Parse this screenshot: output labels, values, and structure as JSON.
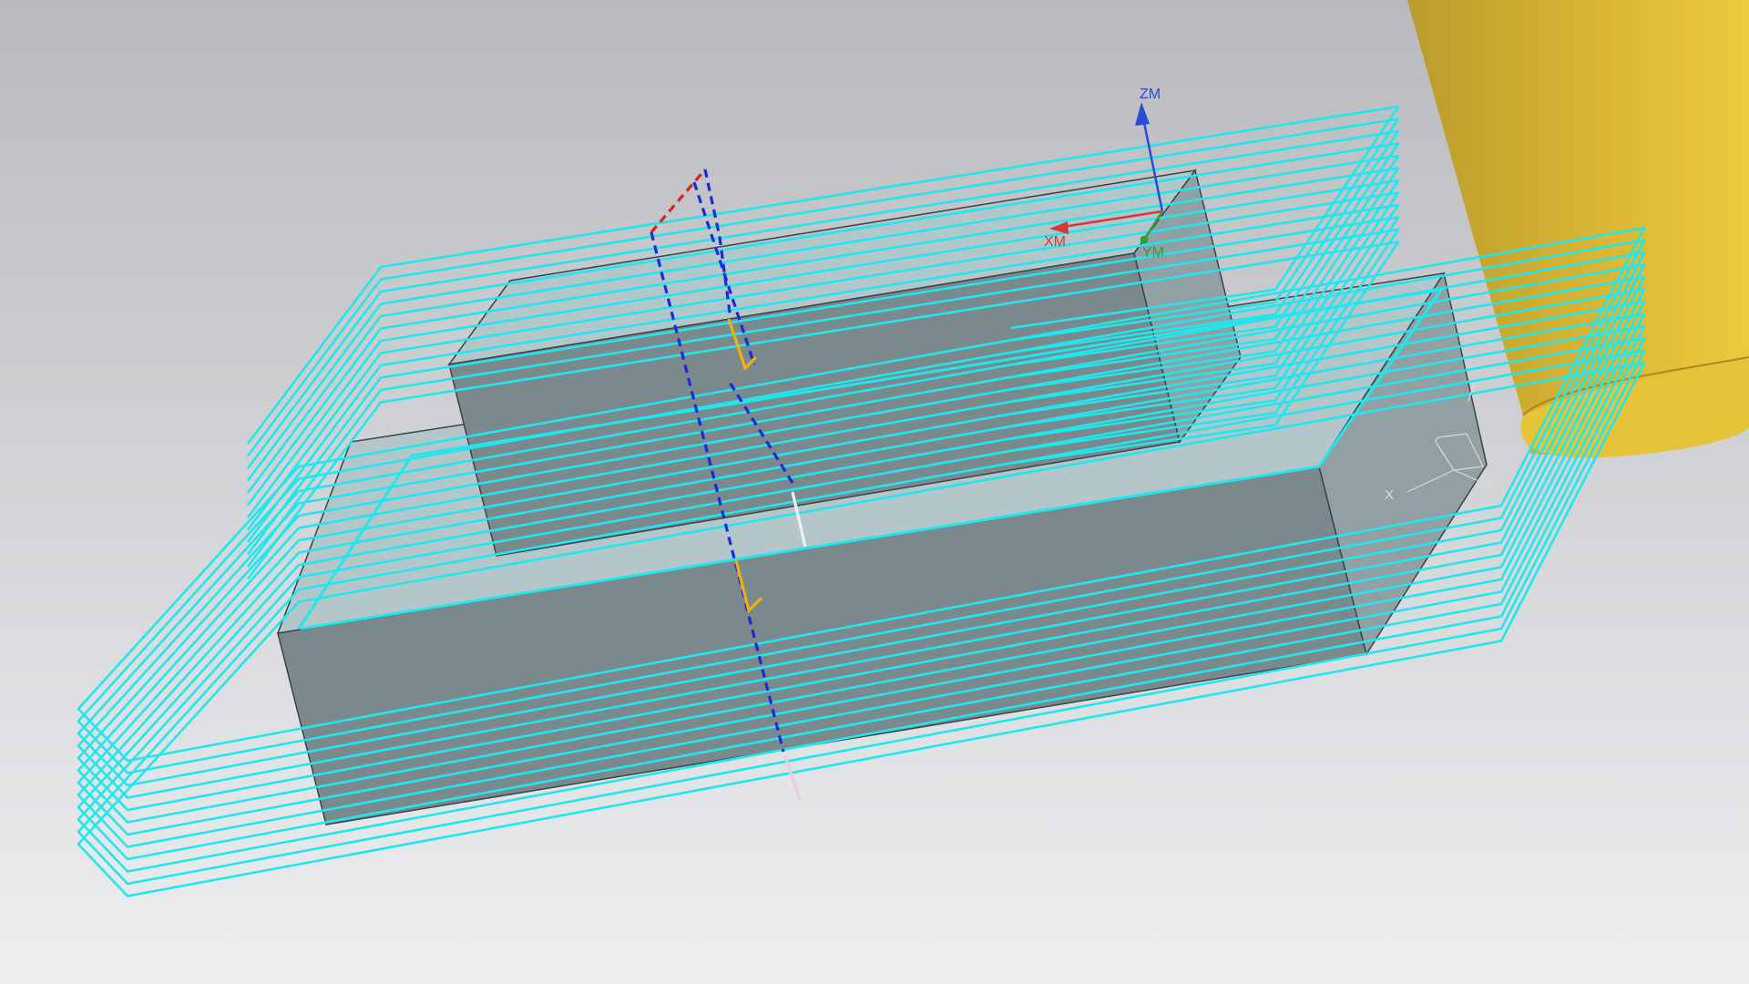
{
  "viewport": {
    "background": {
      "top": "#b8babd",
      "bottom": "#eceef0"
    },
    "colors": {
      "toolpath": "#22e6ee",
      "tool": "#d9b534",
      "tool_shadow": "#b59a2c",
      "top_face": "#b4c6ca",
      "front_face": "#7b898d",
      "side_face": "#929fa3",
      "edge": "#3a4448",
      "axis_x": "#d03a3a",
      "axis_y": "#3a9a3a",
      "axis_z": "#2c4ad8",
      "rapid": "#1a2ad8",
      "approach": "#e02020",
      "engage": "#f0b010",
      "retract": "#f0f0f0",
      "retract2": "#f0c8e0"
    },
    "mcs_axes": {
      "z_label": "ZM",
      "x_label": "XM",
      "y_label": "YM"
    },
    "wcs_axes": {
      "x_label": "X"
    },
    "toolpath_levels": 12
  }
}
